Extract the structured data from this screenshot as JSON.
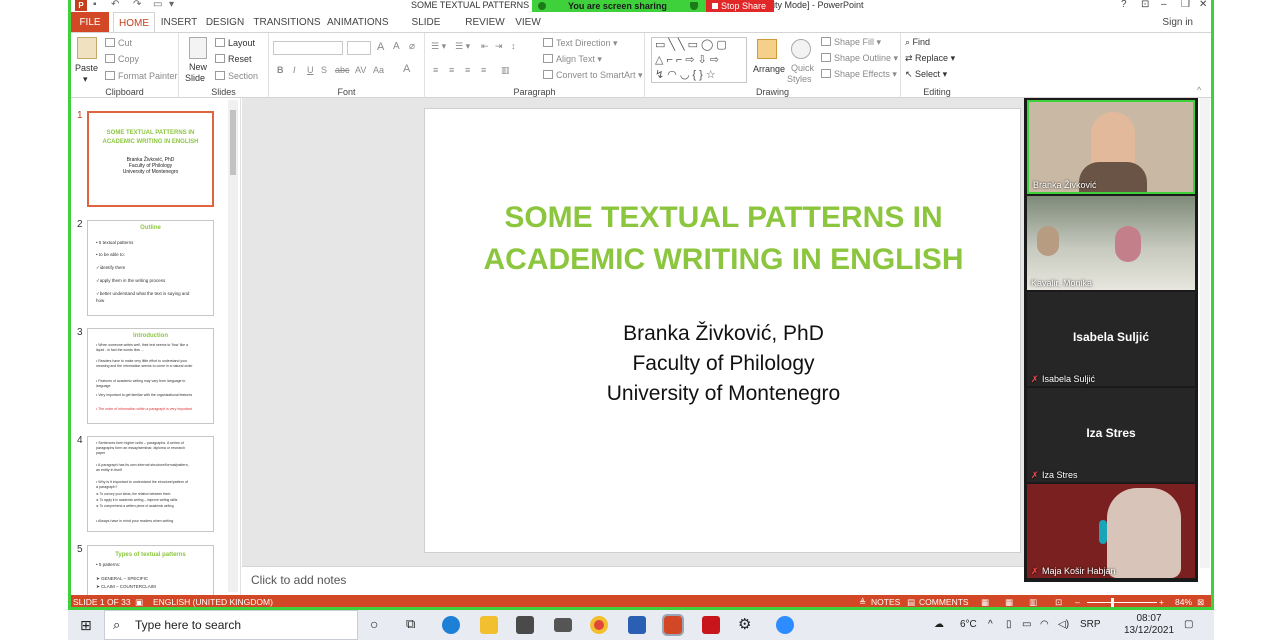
{
  "window": {
    "title_left": "SOME TEXTUAL PATTERNS IN",
    "title_right": "lity Mode] - PowerPoint",
    "minimize": "–",
    "restore": "❐",
    "close": "✕",
    "help": "?"
  },
  "share": {
    "banner": "You are screen sharing",
    "stop": "Stop Share"
  },
  "tabs": [
    {
      "label": "FILE"
    },
    {
      "label": "HOME"
    },
    {
      "label": "INSERT"
    },
    {
      "label": "DESIGN"
    },
    {
      "label": "TRANSITIONS"
    },
    {
      "label": "ANIMATIONS"
    },
    {
      "label": "SLIDE SHOW"
    },
    {
      "label": "REVIEW"
    },
    {
      "label": "VIEW"
    }
  ],
  "signin": "Sign in",
  "ribbon": {
    "clipboard": {
      "label": "Clipboard",
      "paste": "Paste",
      "cut": "Cut",
      "copy": "Copy",
      "format_painter": "Format Painter"
    },
    "slides": {
      "label": "Slides",
      "new_slide_1": "New",
      "new_slide_2": "Slide",
      "layout": "Layout",
      "reset": "Reset",
      "section": "Section"
    },
    "font": {
      "label": "Font",
      "bold": "B",
      "italic": "I",
      "underline": "U",
      "strike": "S",
      "abc": "abc",
      "av": "AV",
      "aa": "Aa",
      "color": "A"
    },
    "paragraph": {
      "label": "Paragraph",
      "text_direction": "Text Direction",
      "align_text": "Align Text",
      "smartart": "Convert to SmartArt"
    },
    "drawing": {
      "label": "Drawing",
      "arrange": "Arrange",
      "quick_styles_1": "Quick",
      "quick_styles_2": "Styles",
      "shape_fill": "Shape Fill",
      "shape_outline": "Shape Outline",
      "shape_effects": "Shape Effects"
    },
    "editing": {
      "label": "Editing",
      "find": "Find",
      "replace": "Replace",
      "select": "Select"
    }
  },
  "thumbnails": [
    {
      "num": "1",
      "title_1": "SOME TEXTUAL PATTERNS IN",
      "title_2": "ACADEMIC WRITING IN ENGLISH",
      "sub_1": "Branka Živković, PhD",
      "sub_2": "Faculty of Philology",
      "sub_3": "University of Montenegro"
    },
    {
      "num": "2",
      "title": "Outline",
      "lines": [
        "•  5 textual patterns",
        "•  to be able to:",
        "✓identify them",
        "✓apply them in the writing process",
        "✓better understand what the text is saying and",
        "   how"
      ]
    },
    {
      "num": "3",
      "title": "Introduction",
      "lines": [
        "•  When someone writes well, their text seems to 'flow' like a",
        "   liquid - in fact the words flow ...",
        "•  Readers have to make very little effort to understand your",
        "   meaning and the information seems to come in a natural order",
        "•  Features of academic writing may vary from language to",
        "   language",
        "•  Very important to get familiar with the organisational features",
        "•  The order of information within a paragraph is very important"
      ]
    },
    {
      "num": "4",
      "lines": [
        "•  Sentences form higher units – paragraphs. A series of",
        "   paragraphs form an essay/seminar, diploma or research",
        "   paper",
        "•  A paragraph has its own internal structure/format/pattern,",
        "   an entity in itself",
        "•  Why is it important to understand the structure/pattern of",
        "   a paragraph?",
        "   ➤ To convey your ideas, the relation between them",
        "   ➤ To apply it in academic writing – improve writing skills",
        "   ➤ To comprehend a written piece of academic writing",
        "•  Always have in mind your readers when writing."
      ]
    },
    {
      "num": "5",
      "title": "Types of textual patterns",
      "lines": [
        "•  5 patterns:",
        "➤ GENERAL – SPECIFIC",
        "➤ CLAIM – COUNTERCLAIM"
      ]
    }
  ],
  "slide": {
    "title_line_1": "SOME TEXTUAL PATTERNS IN",
    "title_line_2": "ACADEMIC WRITING IN ENGLISH",
    "author": "Branka Živković, PhD",
    "faculty": "Faculty of Philology",
    "university": "University of Montenegro"
  },
  "notes_placeholder": "Click to add notes",
  "gallery": [
    {
      "name": "Branka Živković",
      "type": "video"
    },
    {
      "name": "Kavalir, Monika",
      "type": "video"
    },
    {
      "name": "Isabela Suljić",
      "center": "Isabela Suljić",
      "type": "name",
      "muted": true
    },
    {
      "name": "Iza Stres",
      "center": "Iza Stres",
      "type": "name",
      "muted": true
    },
    {
      "name": "Maja Košir Habjan",
      "type": "video",
      "muted": true
    }
  ],
  "status": {
    "slide": "SLIDE 1 OF 33",
    "language": "ENGLISH (UNITED KINGDOM)",
    "notes": "NOTES",
    "comments": "COMMENTS",
    "zoom": "84%"
  },
  "taskbar": {
    "search_placeholder": "Type here to search",
    "weather": "6°C",
    "lang": "SRP",
    "time": "08:07",
    "date": "13/12/2021"
  },
  "colors": {
    "accent": "#d24726",
    "slide_title": "#8cc63f",
    "share_green": "#3fd13c",
    "stop_red": "#e02828"
  }
}
